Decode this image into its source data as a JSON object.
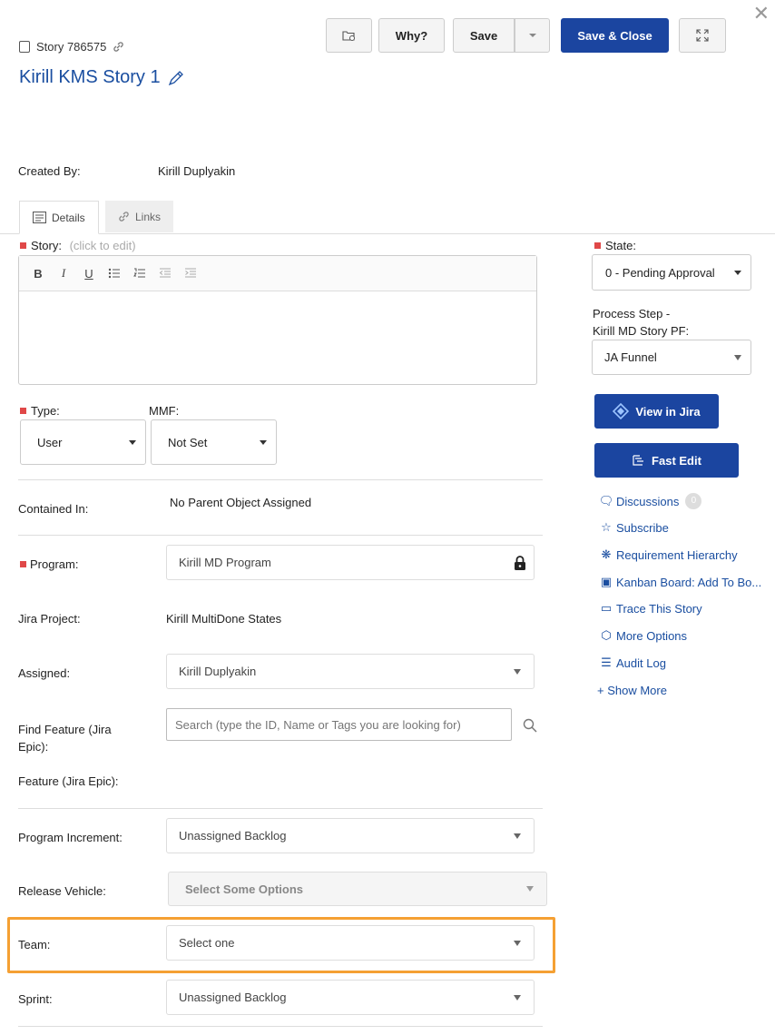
{
  "header": {
    "story_id": "Story 786575",
    "title": "Kirill KMS Story 1",
    "buttons": {
      "why": "Why?",
      "save": "Save",
      "save_close": "Save & Close"
    }
  },
  "created": {
    "label": "Created By:",
    "value": "Kirill Duplyakin"
  },
  "tabs": [
    {
      "label": "Details",
      "active": true
    },
    {
      "label": "Links",
      "active": false
    }
  ],
  "story_field": {
    "label": "Story:",
    "hint": "(click to edit)"
  },
  "type_field": {
    "label": "Type:",
    "value": "User"
  },
  "mmf_field": {
    "label": "MMF:",
    "value": "Not Set"
  },
  "contained_in": {
    "label": "Contained In:",
    "value": "No Parent Object Assigned"
  },
  "program": {
    "label": "Program:",
    "value": "Kirill MD Program"
  },
  "jira_project": {
    "label": "Jira Project:",
    "value": "Kirill MultiDone States"
  },
  "assigned": {
    "label": "Assigned:",
    "value": "Kirill Duplyakin"
  },
  "find_feature": {
    "label": "Find Feature (Jira Epic):",
    "placeholder": "Search (type the ID, Name or Tags you are looking for)"
  },
  "feature": {
    "label": "Feature (Jira Epic):"
  },
  "program_increment": {
    "label": "Program Increment:",
    "value": "Unassigned Backlog"
  },
  "release_vehicle": {
    "label": "Release Vehicle:",
    "value": "Select Some Options"
  },
  "team": {
    "label": "Team:",
    "value": "Select one"
  },
  "sprint": {
    "label": "Sprint:",
    "value": "Unassigned Backlog"
  },
  "sidebar": {
    "state_label": "State:",
    "state_value": "0 - Pending Approval",
    "process_step_label": "Process Step -",
    "process_step_label2": "Kirill MD Story PF:",
    "process_step_value": "JA Funnel",
    "view_in_jira": "View in Jira",
    "fast_edit": "Fast Edit",
    "links": [
      {
        "label": "Discussions",
        "icon": "chat-icon",
        "badge": "0"
      },
      {
        "label": "Subscribe",
        "icon": "star-icon"
      },
      {
        "label": "Requirement Hierarchy",
        "icon": "hierarchy-icon"
      },
      {
        "label": "Kanban Board: Add To Bo...",
        "icon": "kanban-icon"
      },
      {
        "label": "Trace This Story",
        "icon": "trace-icon"
      },
      {
        "label": "More Options",
        "icon": "cube-icon"
      },
      {
        "label": "Audit Log",
        "icon": "log-icon"
      }
    ],
    "show_more": "+ Show More"
  },
  "colors": {
    "brand": "#1b45a0",
    "link": "#1a4ea0",
    "required": "#e04848",
    "highlight": "#f5a033"
  }
}
